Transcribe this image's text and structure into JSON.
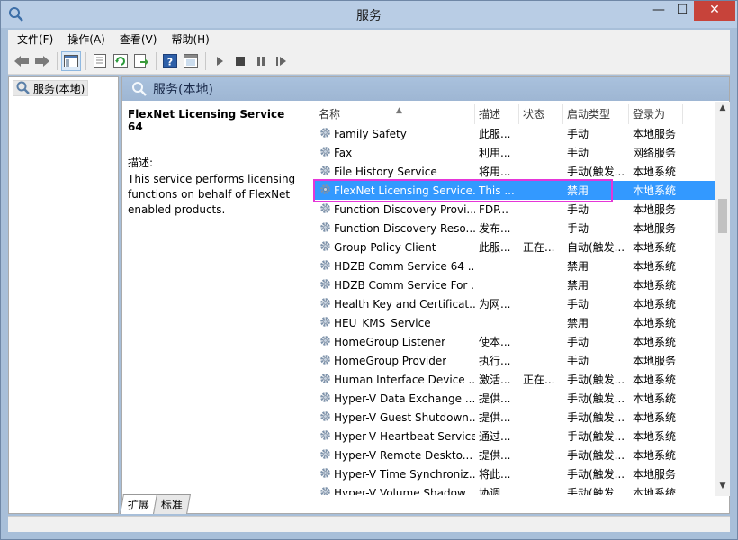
{
  "window": {
    "title": "服务",
    "minimize": "—",
    "maximize": "☐",
    "close": "✕"
  },
  "menu": [
    "文件(F)",
    "操作(A)",
    "查看(V)",
    "帮助(H)"
  ],
  "toolbar_icons": [
    "back-icon",
    "forward-icon",
    "console-tree-icon",
    "properties-icon",
    "refresh-icon",
    "export-icon",
    "help-icon",
    "view-icon",
    "play-icon",
    "stop-icon",
    "pause-icon",
    "restart-icon"
  ],
  "tree": {
    "root_label": "服务(本地)"
  },
  "main": {
    "header": "服务(本地)",
    "detail": {
      "title": "FlexNet Licensing Service 64",
      "desc_label": "描述:",
      "desc_text": "This service performs licensing functions on behalf of FlexNet enabled products."
    },
    "columns": [
      "名称",
      "描述",
      "状态",
      "启动类型",
      "登录为"
    ],
    "rows": [
      {
        "name": "Family Safety",
        "desc": "此服...",
        "status": "",
        "startup": "手动",
        "logon": "本地服务"
      },
      {
        "name": "Fax",
        "desc": "利用...",
        "status": "",
        "startup": "手动",
        "logon": "网络服务"
      },
      {
        "name": "File History Service",
        "desc": "将用...",
        "status": "",
        "startup": "手动(触发...",
        "logon": "本地系统"
      },
      {
        "name": "FlexNet Licensing Service...",
        "desc": "This ...",
        "status": "",
        "startup": "禁用",
        "logon": "本地系统",
        "selected": true
      },
      {
        "name": "Function Discovery Provi...",
        "desc": "FDP...",
        "status": "",
        "startup": "手动",
        "logon": "本地服务"
      },
      {
        "name": "Function Discovery Reso...",
        "desc": "发布...",
        "status": "",
        "startup": "手动",
        "logon": "本地服务"
      },
      {
        "name": "Group Policy Client",
        "desc": "此服...",
        "status": "正在...",
        "startup": "自动(触发...",
        "logon": "本地系统"
      },
      {
        "name": "HDZB Comm Service 64 ...",
        "desc": "",
        "status": "",
        "startup": "禁用",
        "logon": "本地系统"
      },
      {
        "name": "HDZB Comm Service For ...",
        "desc": "",
        "status": "",
        "startup": "禁用",
        "logon": "本地系统"
      },
      {
        "name": "Health Key and Certificat...",
        "desc": "为网...",
        "status": "",
        "startup": "手动",
        "logon": "本地系统"
      },
      {
        "name": "HEU_KMS_Service",
        "desc": "",
        "status": "",
        "startup": "禁用",
        "logon": "本地系统"
      },
      {
        "name": "HomeGroup Listener",
        "desc": "使本...",
        "status": "",
        "startup": "手动",
        "logon": "本地系统"
      },
      {
        "name": "HomeGroup Provider",
        "desc": "执行...",
        "status": "",
        "startup": "手动",
        "logon": "本地服务"
      },
      {
        "name": "Human Interface Device ...",
        "desc": "激活...",
        "status": "正在...",
        "startup": "手动(触发...",
        "logon": "本地系统"
      },
      {
        "name": "Hyper-V Data Exchange ...",
        "desc": "提供...",
        "status": "",
        "startup": "手动(触发...",
        "logon": "本地系统"
      },
      {
        "name": "Hyper-V Guest Shutdown...",
        "desc": "提供...",
        "status": "",
        "startup": "手动(触发...",
        "logon": "本地系统"
      },
      {
        "name": "Hyper-V Heartbeat Service",
        "desc": "通过...",
        "status": "",
        "startup": "手动(触发...",
        "logon": "本地系统"
      },
      {
        "name": "Hyper-V Remote Deskto...",
        "desc": "提供...",
        "status": "",
        "startup": "手动(触发...",
        "logon": "本地系统"
      },
      {
        "name": "Hyper-V Time Synchroniz...",
        "desc": "将此...",
        "status": "",
        "startup": "手动(触发...",
        "logon": "本地服务"
      },
      {
        "name": "Hyper-V Volume Shadow...",
        "desc": "协调...",
        "status": "",
        "startup": "手动(触发...",
        "logon": "本地系统"
      }
    ]
  },
  "tabs": [
    "扩展",
    "标准"
  ],
  "colors": {
    "selection": "#3399ff",
    "highlight_box": "#e536d8",
    "title_bar": "#b9cde5",
    "close_button": "#c7433a"
  }
}
